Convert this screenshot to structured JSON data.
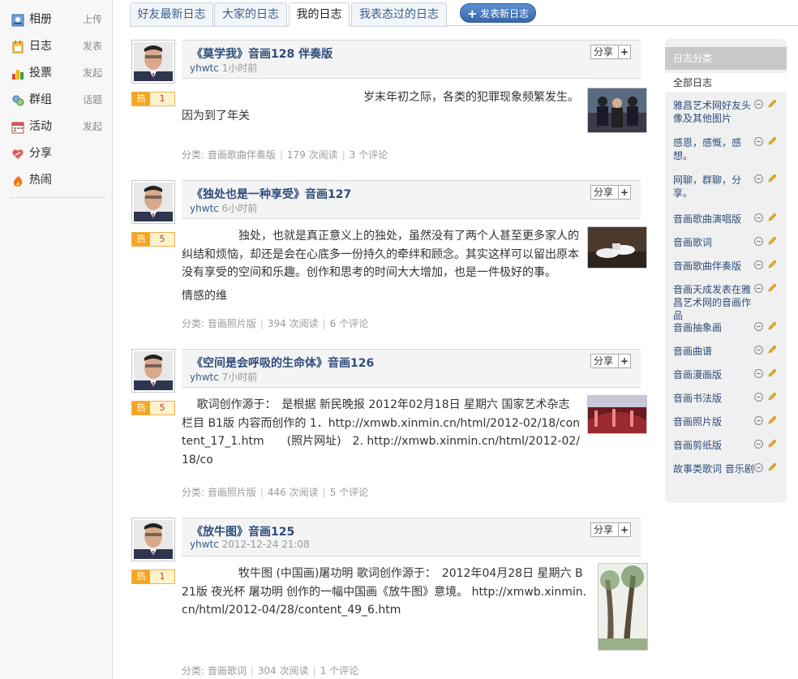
{
  "nav": [
    {
      "label": "相册",
      "action": "上传",
      "icon": "photo-icon"
    },
    {
      "label": "日志",
      "action": "发表",
      "icon": "journal-icon"
    },
    {
      "label": "投票",
      "action": "发起",
      "icon": "vote-icon"
    },
    {
      "label": "群组",
      "action": "话题",
      "icon": "group-icon"
    },
    {
      "label": "活动",
      "action": "发起",
      "icon": "calendar-icon"
    },
    {
      "label": "分享",
      "action": "",
      "icon": "heart-icon"
    },
    {
      "label": "热闹",
      "action": "",
      "icon": "fire-icon"
    }
  ],
  "tabs": [
    "好友最新日志",
    "大家的日志",
    "我的日志",
    "我表态过的日志"
  ],
  "active_tab": "我的日志",
  "new_post_label": "发表新日志",
  "share_label": "分享",
  "share_plus": "+",
  "hot_label": "热",
  "posts": [
    {
      "title": "《莫学我》音画128 伴奏版",
      "author": "yhwtc",
      "time": "1小时前",
      "hot": "1",
      "body": "　　　　　　　　　　　　　　　　岁末年初之际，各类的犯罪现象频繁发生。因为到了年关",
      "category": "分类: 音画歌曲伴奏版",
      "reads": "179 次阅读",
      "comments": "3 个评论"
    },
    {
      "title": "《独处也是一种享受》音画127",
      "author": "yhwtc",
      "time": "6小时前",
      "hot": "5",
      "body": "　　　　　独处，也就是真正意义上的独处，虽然没有了两个人甚至更多家人的纠结和烦恼，却还是会在心底多一份持久的牵绊和顾念。其实这样可以留出原本没有享受的空间和乐趣。创作和思考的时间大大增加，也是一件极好的事。",
      "body2": "情感的维",
      "category": "分类: 音画照片版",
      "reads": "394 次阅读",
      "comments": "6 个评论"
    },
    {
      "title": "《空间是会呼吸的生命体》音画126",
      "author": "yhwtc",
      "time": "7小时前",
      "hot": "5",
      "body": "　 歌词创作源于：　是根据 新民晚报 2012年02月18日 星期六 国家艺术杂志 栏目 B1版 内容而创作的 1．http://xmwb.xinmin.cn/html/2012-02/18/content_17_1.htm　　(照片网址)　2. http://xmwb.xinmin.cn/html/2012-02/18/co",
      "category": "分类: 音画照片版",
      "reads": "446 次阅读",
      "comments": "5 个评论"
    },
    {
      "title": "《放牛图》音画125",
      "author": "yhwtc",
      "time": "2012-12-24 21:08",
      "hot": "1",
      "body": "　　　　　牧牛图 (中国画)屠功明 歌词创作源于：　2012年04月28日 星期六 B21版 夜光杯 屠功明 创作的一幅中国画《放牛图》意境。 http://xmwb.xinmin.cn/html/2012-04/28/content_49_6.htm",
      "category": "分类: 音画歌词",
      "reads": "304 次阅读",
      "comments": "1 个评论"
    }
  ],
  "sidebar": {
    "title": "日志分类",
    "all": "全部日志",
    "categories": [
      "雅昌艺术网好友头像及其他图片",
      "感恩，感慨，感想。",
      "网聊，群聊，分享。",
      "音画歌曲演唱版",
      "音画歌词",
      "音画歌曲伴奏版",
      "音画天成发表在雅昌艺术网的音画作品",
      "音画抽象画",
      "音画曲谱",
      "音画漫画版",
      "音画书法版",
      "音画照片版",
      "音画剪纸版",
      "故事类歌词 音乐剧"
    ]
  },
  "colors": {
    "link": "#2f4d7a",
    "accent": "#3a67ab",
    "hot": "#f5a623"
  }
}
